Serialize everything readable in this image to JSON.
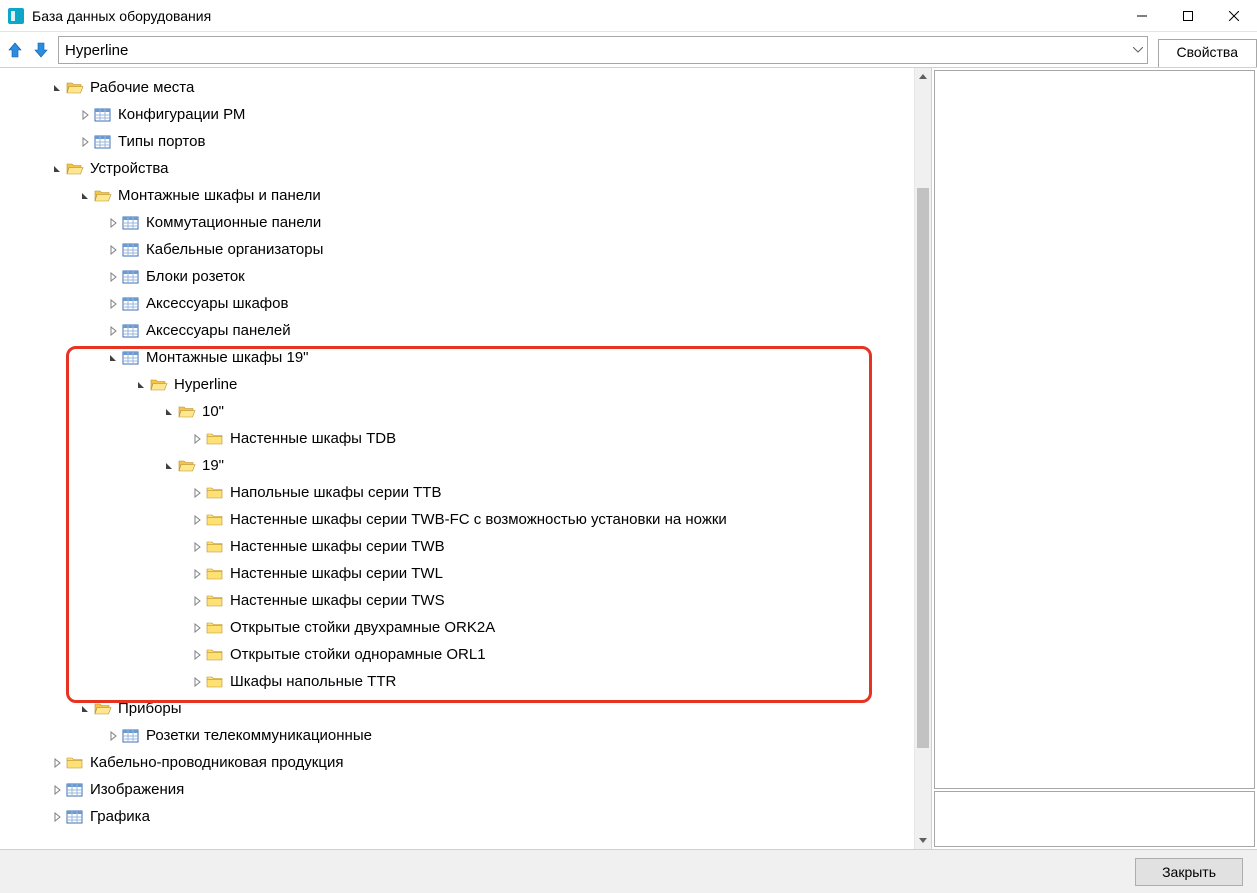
{
  "window": {
    "title": "База данных оборудования"
  },
  "breadcrumb": {
    "text": "Hyperline"
  },
  "tab_properties": "Свойства",
  "tree": {
    "rabochie_mesta": "Рабочие места",
    "konfiguratsii_rm": "Конфигурации РМ",
    "tipy_portov": "Типы портов",
    "ustroistva": "Устройства",
    "montazhnye_shkafy_i_paneli": "Монтажные шкафы и панели",
    "kommutatsionnye_paneli": "Коммутационные панели",
    "kabelnye_organizatory": "Кабельные организаторы",
    "bloki_rozetok": "Блоки розеток",
    "aksessuary_shkafov": "Аксессуары шкафов",
    "aksessuary_panelei": "Аксессуары панелей",
    "montazhnye_shkafy_19": "Монтажные шкафы 19\"",
    "hyperline": "Hyperline",
    "ten_inch": "10\"",
    "nastennye_shkafy_tdb": "Настенные шкафы TDB",
    "nineteen_inch": "19\"",
    "napolnye_shkafy_ttb": "Напольные шкафы серии TTB",
    "nastennye_shkafy_twb_fc": "Настенные шкафы  серии TWB-FC с возможностью установки на ножки",
    "nastennye_shkafy_twb": "Настенные шкафы серии TWB",
    "nastennye_shkafy_twl": "Настенные шкафы серии TWL",
    "nastennye_shkafy_tws": "Настенные шкафы серии TWS",
    "otkrytye_stoiki_ork2a": "Открытые стойки двухрамные ORK2A",
    "otkrytye_stoiki_orl1": "Открытые стойки однорамные ORL1",
    "shkafy_napolnye_ttr": "Шкафы напольные TTR",
    "pribory": "Приборы",
    "rozetki_telekom": "Розетки телекоммуникационные",
    "kabelno_provodnikovaia": "Кабельно-проводниковая продукция",
    "izobrazheniia": "Изображения",
    "grafika": "Графика"
  },
  "footer": {
    "close": "Закрыть"
  }
}
